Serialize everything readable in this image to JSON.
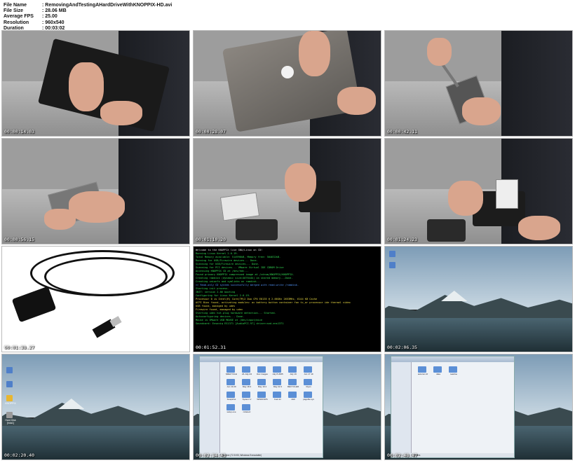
{
  "meta": {
    "rows": [
      {
        "label": "File Name",
        "value": ": RemovingAndTestingAHardDriveWithKNOPPIX-HD.avi"
      },
      {
        "label": "File Size",
        "value": ": 28.06 MB"
      },
      {
        "label": "Average FPS",
        "value": ": 25.00"
      },
      {
        "label": "Resolution",
        "value": ": 960x540"
      },
      {
        "label": "Duration",
        "value": ": 00:03:02"
      }
    ]
  },
  "thumbnails": [
    {
      "timestamp": "00:00:14.03",
      "scene": "laptop-underside"
    },
    {
      "timestamp": "00:00:28.07",
      "scene": "laptop-lid"
    },
    {
      "timestamp": "00:00:42.11",
      "scene": "screwdriver-drive"
    },
    {
      "timestamp": "00:00:56.15",
      "scene": "holding-drive"
    },
    {
      "timestamp": "00:01:10.20",
      "scene": "drive-on-desk"
    },
    {
      "timestamp": "00:01:24.23",
      "scene": "drive-in-dock"
    },
    {
      "timestamp": "00:01:38.27",
      "scene": "usb-adapter-cable"
    },
    {
      "timestamp": "00:01:52.31",
      "scene": "boot-terminal"
    },
    {
      "timestamp": "00:02:06.35",
      "scene": "desktop-wallpaper"
    },
    {
      "timestamp": "00:02:20.40",
      "scene": "desktop-icons"
    },
    {
      "timestamp": "00:02:34.43",
      "scene": "file-manager-many"
    },
    {
      "timestamp": "00:02:48.47",
      "scene": "file-manager-few"
    }
  ],
  "terminal": {
    "lines": [
      "Welcome to the KNOPPIX live GNU/Linux on CD!",
      "",
      "Running Linux Kernel 2.6.19.",
      "Total Memory available: 514996kB, Memory free: 504632kB.",
      "Running for USB/Firewire devices... Done.",
      "Scanning for USB/Firewire devices... Done.",
      "Scanning for PCI devices...        VMware Virtual IDE CDROM Drive",
      "Accessing KNOPPIX CD at /dev/hdc...",
      "Found primary KNOPPIX compressed image at /cdrom/KNOPPIX/KNOPPIX.",
      "Creating ramdisk (dynamic size=407644k) on shared memory...Done.",
      "Creating unionfs and symlinks on ramdisk...",
      ">> Read-only CD system successfully merged with read-write /ramdisk.",
      "",
      "Starting init process.",
      "INIT: version 2.86 booting",
      "Configuring for Linux Kernel 2.6.19.",
      "Processor 0 is  Intel(R) Core(TM)2 Duo CPU    E8135  @ 2.66GHz 2653MHz, 6144 KB Cache",
      "ACPI Bios found, activating modules: ac battery button container fan tc_or processor ide thermal video",
      "USB found, managed by udev",
      "Firewire found, managed by udev",
      "Starting udev hot-plug hardware detection... Started.",
      "Autoconfiguring devices...                    Done.",
      "Mouse is VMware USB MOUSE at /dev/input/mice",
      "Soundcard: Ensoniq ES1371 [AudioPCI-97] driver=snd-ens1371"
    ]
  },
  "desktop_icons": [
    {
      "label": "KNOPPIX"
    },
    {
      "label": "Hard Disk [hda1]"
    }
  ],
  "file_manager_many": {
    "items": [
      "$RECYCLE",
      "24-July-04",
      "Doc images",
      "July 8 2005",
      "July 19",
      "Jun 17 19",
      "Jun 19 20",
      "May 18 2",
      "May 19 2",
      "May 22 2",
      "RECYCLER",
      "Ryan",
      "Snapshot",
      "System V",
      "WINDOWS",
      "boot.ini",
      "ntldr",
      "pagefile.sys",
      "setup.exe",
      "ntdetect"
    ],
    "status": "Setup.exe (72.5 KB, Windows Executable)"
  },
  "file_manager_few": {
    "items": [
      "autorun.inf",
      "data",
      "readme"
    ],
    "status": "3 Folders"
  },
  "colors": {
    "timestamp_text": "#ffffff",
    "terminal_bg": "#000000",
    "terminal_green": "#33dd55",
    "terminal_yellow": "#eedd44",
    "terminal_white": "#dddddd",
    "folder_blue": "#5b8fd6"
  }
}
